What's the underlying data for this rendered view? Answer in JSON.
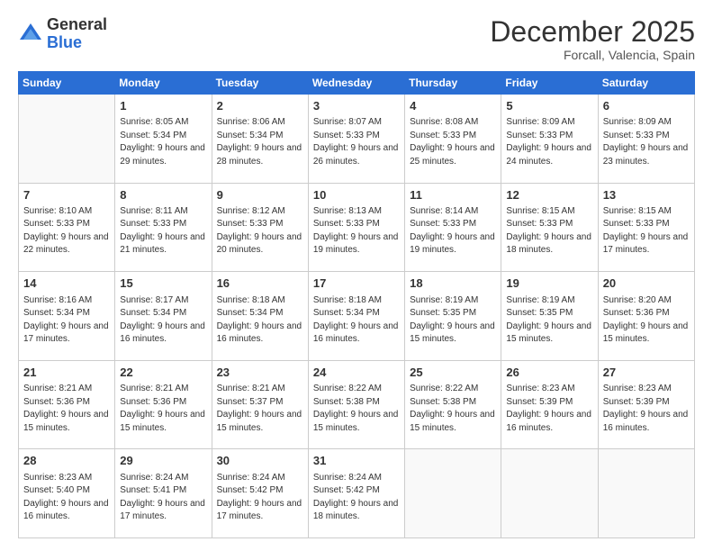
{
  "header": {
    "logo_general": "General",
    "logo_blue": "Blue",
    "month_title": "December 2025",
    "location": "Forcall, Valencia, Spain"
  },
  "days_of_week": [
    "Sunday",
    "Monday",
    "Tuesday",
    "Wednesday",
    "Thursday",
    "Friday",
    "Saturday"
  ],
  "weeks": [
    [
      {
        "day": "",
        "sunrise": "",
        "sunset": "",
        "daylight": ""
      },
      {
        "day": "1",
        "sunrise": "Sunrise: 8:05 AM",
        "sunset": "Sunset: 5:34 PM",
        "daylight": "Daylight: 9 hours and 29 minutes."
      },
      {
        "day": "2",
        "sunrise": "Sunrise: 8:06 AM",
        "sunset": "Sunset: 5:34 PM",
        "daylight": "Daylight: 9 hours and 28 minutes."
      },
      {
        "day": "3",
        "sunrise": "Sunrise: 8:07 AM",
        "sunset": "Sunset: 5:33 PM",
        "daylight": "Daylight: 9 hours and 26 minutes."
      },
      {
        "day": "4",
        "sunrise": "Sunrise: 8:08 AM",
        "sunset": "Sunset: 5:33 PM",
        "daylight": "Daylight: 9 hours and 25 minutes."
      },
      {
        "day": "5",
        "sunrise": "Sunrise: 8:09 AM",
        "sunset": "Sunset: 5:33 PM",
        "daylight": "Daylight: 9 hours and 24 minutes."
      },
      {
        "day": "6",
        "sunrise": "Sunrise: 8:09 AM",
        "sunset": "Sunset: 5:33 PM",
        "daylight": "Daylight: 9 hours and 23 minutes."
      }
    ],
    [
      {
        "day": "7",
        "sunrise": "Sunrise: 8:10 AM",
        "sunset": "Sunset: 5:33 PM",
        "daylight": "Daylight: 9 hours and 22 minutes."
      },
      {
        "day": "8",
        "sunrise": "Sunrise: 8:11 AM",
        "sunset": "Sunset: 5:33 PM",
        "daylight": "Daylight: 9 hours and 21 minutes."
      },
      {
        "day": "9",
        "sunrise": "Sunrise: 8:12 AM",
        "sunset": "Sunset: 5:33 PM",
        "daylight": "Daylight: 9 hours and 20 minutes."
      },
      {
        "day": "10",
        "sunrise": "Sunrise: 8:13 AM",
        "sunset": "Sunset: 5:33 PM",
        "daylight": "Daylight: 9 hours and 19 minutes."
      },
      {
        "day": "11",
        "sunrise": "Sunrise: 8:14 AM",
        "sunset": "Sunset: 5:33 PM",
        "daylight": "Daylight: 9 hours and 19 minutes."
      },
      {
        "day": "12",
        "sunrise": "Sunrise: 8:15 AM",
        "sunset": "Sunset: 5:33 PM",
        "daylight": "Daylight: 9 hours and 18 minutes."
      },
      {
        "day": "13",
        "sunrise": "Sunrise: 8:15 AM",
        "sunset": "Sunset: 5:33 PM",
        "daylight": "Daylight: 9 hours and 17 minutes."
      }
    ],
    [
      {
        "day": "14",
        "sunrise": "Sunrise: 8:16 AM",
        "sunset": "Sunset: 5:34 PM",
        "daylight": "Daylight: 9 hours and 17 minutes."
      },
      {
        "day": "15",
        "sunrise": "Sunrise: 8:17 AM",
        "sunset": "Sunset: 5:34 PM",
        "daylight": "Daylight: 9 hours and 16 minutes."
      },
      {
        "day": "16",
        "sunrise": "Sunrise: 8:18 AM",
        "sunset": "Sunset: 5:34 PM",
        "daylight": "Daylight: 9 hours and 16 minutes."
      },
      {
        "day": "17",
        "sunrise": "Sunrise: 8:18 AM",
        "sunset": "Sunset: 5:34 PM",
        "daylight": "Daylight: 9 hours and 16 minutes."
      },
      {
        "day": "18",
        "sunrise": "Sunrise: 8:19 AM",
        "sunset": "Sunset: 5:35 PM",
        "daylight": "Daylight: 9 hours and 15 minutes."
      },
      {
        "day": "19",
        "sunrise": "Sunrise: 8:19 AM",
        "sunset": "Sunset: 5:35 PM",
        "daylight": "Daylight: 9 hours and 15 minutes."
      },
      {
        "day": "20",
        "sunrise": "Sunrise: 8:20 AM",
        "sunset": "Sunset: 5:36 PM",
        "daylight": "Daylight: 9 hours and 15 minutes."
      }
    ],
    [
      {
        "day": "21",
        "sunrise": "Sunrise: 8:21 AM",
        "sunset": "Sunset: 5:36 PM",
        "daylight": "Daylight: 9 hours and 15 minutes."
      },
      {
        "day": "22",
        "sunrise": "Sunrise: 8:21 AM",
        "sunset": "Sunset: 5:36 PM",
        "daylight": "Daylight: 9 hours and 15 minutes."
      },
      {
        "day": "23",
        "sunrise": "Sunrise: 8:21 AM",
        "sunset": "Sunset: 5:37 PM",
        "daylight": "Daylight: 9 hours and 15 minutes."
      },
      {
        "day": "24",
        "sunrise": "Sunrise: 8:22 AM",
        "sunset": "Sunset: 5:38 PM",
        "daylight": "Daylight: 9 hours and 15 minutes."
      },
      {
        "day": "25",
        "sunrise": "Sunrise: 8:22 AM",
        "sunset": "Sunset: 5:38 PM",
        "daylight": "Daylight: 9 hours and 15 minutes."
      },
      {
        "day": "26",
        "sunrise": "Sunrise: 8:23 AM",
        "sunset": "Sunset: 5:39 PM",
        "daylight": "Daylight: 9 hours and 16 minutes."
      },
      {
        "day": "27",
        "sunrise": "Sunrise: 8:23 AM",
        "sunset": "Sunset: 5:39 PM",
        "daylight": "Daylight: 9 hours and 16 minutes."
      }
    ],
    [
      {
        "day": "28",
        "sunrise": "Sunrise: 8:23 AM",
        "sunset": "Sunset: 5:40 PM",
        "daylight": "Daylight: 9 hours and 16 minutes."
      },
      {
        "day": "29",
        "sunrise": "Sunrise: 8:24 AM",
        "sunset": "Sunset: 5:41 PM",
        "daylight": "Daylight: 9 hours and 17 minutes."
      },
      {
        "day": "30",
        "sunrise": "Sunrise: 8:24 AM",
        "sunset": "Sunset: 5:42 PM",
        "daylight": "Daylight: 9 hours and 17 minutes."
      },
      {
        "day": "31",
        "sunrise": "Sunrise: 8:24 AM",
        "sunset": "Sunset: 5:42 PM",
        "daylight": "Daylight: 9 hours and 18 minutes."
      },
      {
        "day": "",
        "sunrise": "",
        "sunset": "",
        "daylight": ""
      },
      {
        "day": "",
        "sunrise": "",
        "sunset": "",
        "daylight": ""
      },
      {
        "day": "",
        "sunrise": "",
        "sunset": "",
        "daylight": ""
      }
    ]
  ]
}
